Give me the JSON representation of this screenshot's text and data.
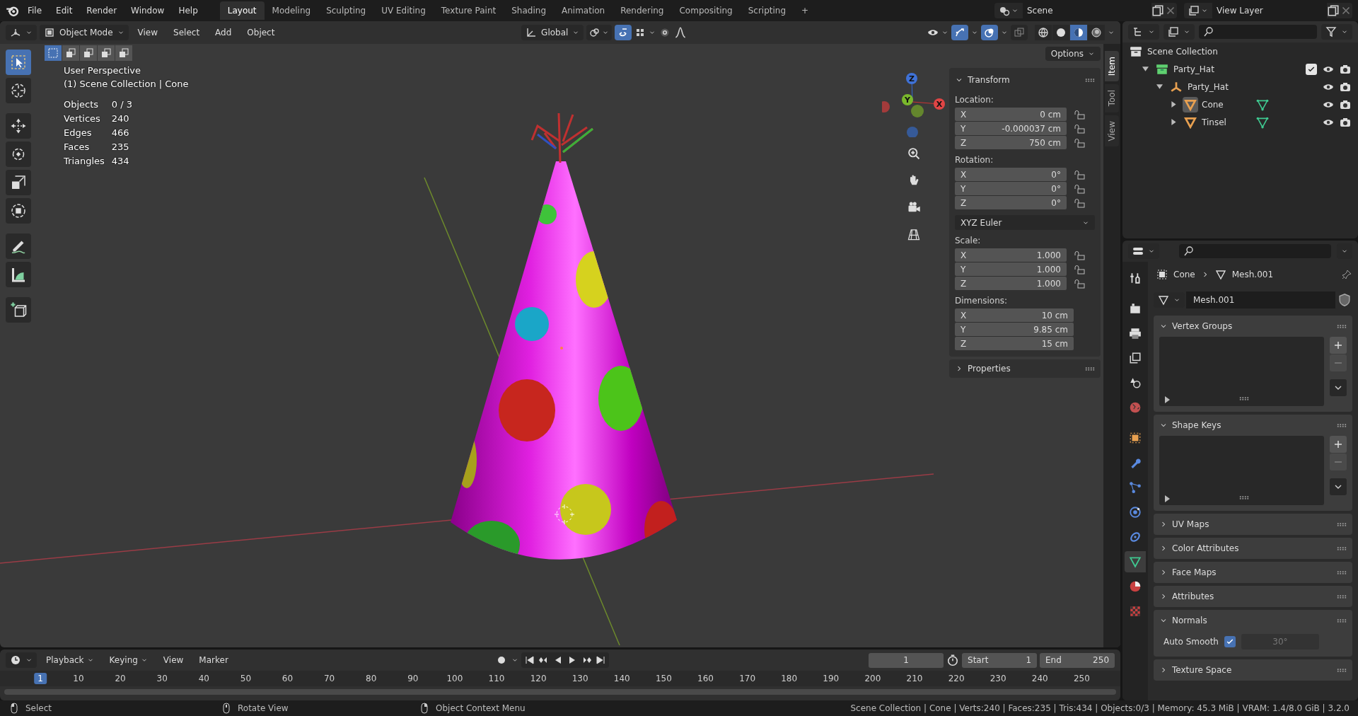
{
  "menu": [
    "File",
    "Edit",
    "Render",
    "Window",
    "Help"
  ],
  "workspaces": [
    {
      "label": "Layout",
      "selected": true
    },
    {
      "label": "Modeling",
      "selected": false
    },
    {
      "label": "Sculpting",
      "selected": false
    },
    {
      "label": "UV Editing",
      "selected": false
    },
    {
      "label": "Texture Paint",
      "selected": false
    },
    {
      "label": "Shading",
      "selected": false
    },
    {
      "label": "Animation",
      "selected": false
    },
    {
      "label": "Rendering",
      "selected": false
    },
    {
      "label": "Compositing",
      "selected": false
    },
    {
      "label": "Scripting",
      "selected": false
    }
  ],
  "add_workspace": "+",
  "scene": "Scene",
  "view_layer": "View Layer",
  "viewport_header": {
    "mode": "Object Mode",
    "menus": [
      "View",
      "Select",
      "Add",
      "Object"
    ],
    "orientation": "Global",
    "options": "Options",
    "toggles": [
      {
        "kind": "snap",
        "on": true
      },
      {
        "kind": "gizmos",
        "on": true
      },
      {
        "kind": "overlays",
        "on": true
      },
      {
        "kind": "xray",
        "on": false
      }
    ],
    "shading": [
      {
        "kind": "wireframe",
        "selected": false
      },
      {
        "kind": "solid",
        "selected": false
      },
      {
        "kind": "material",
        "selected": true
      },
      {
        "kind": "rendered",
        "selected": false
      }
    ],
    "select_modes": [
      {
        "kind": "new",
        "selected": true
      },
      {
        "kind": "extend",
        "selected": false
      },
      {
        "kind": "subtract",
        "selected": false
      },
      {
        "kind": "invert",
        "selected": false
      },
      {
        "kind": "intersect",
        "selected": false
      }
    ]
  },
  "tools": [
    {
      "kind": "select",
      "selected": true
    },
    {
      "kind": "cursor",
      "selected": false
    },
    {
      "kind": "move",
      "selected": false
    },
    {
      "kind": "rotate",
      "selected": false
    },
    {
      "kind": "scale",
      "selected": false
    },
    {
      "kind": "transform",
      "selected": false
    },
    {
      "kind": "annotate",
      "selected": false
    },
    {
      "kind": "measure",
      "selected": false
    },
    {
      "kind": "add_cube",
      "selected": false
    }
  ],
  "overlay": {
    "view": "User Perspective",
    "context": "(1) Scene Collection | Cone",
    "stats": [
      {
        "label": "Objects",
        "value": "0 / 3"
      },
      {
        "label": "Vertices",
        "value": "240"
      },
      {
        "label": "Edges",
        "value": "466"
      },
      {
        "label": "Faces",
        "value": "235"
      },
      {
        "label": "Triangles",
        "value": "434"
      }
    ]
  },
  "gizmo_axes": [
    "Z",
    "Y",
    "X"
  ],
  "n_panel": {
    "tabs": [
      {
        "label": "Item",
        "selected": true
      },
      {
        "label": "Tool",
        "selected": false
      },
      {
        "label": "View",
        "selected": false
      }
    ],
    "transform": {
      "title": "Transform",
      "expanded": true,
      "groups": [
        {
          "kind": "vector",
          "label": "Location:",
          "fields": [
            {
              "axis": "X",
              "value": "0 cm",
              "locked": false
            },
            {
              "axis": "Y",
              "value": "-0.000037 cm",
              "locked": false
            },
            {
              "axis": "Z",
              "value": "750 cm",
              "locked": false
            }
          ]
        },
        {
          "kind": "vector",
          "label": "Rotation:",
          "fields": [
            {
              "axis": "X",
              "value": "0°",
              "locked": false
            },
            {
              "axis": "Y",
              "value": "0°",
              "locked": false
            },
            {
              "axis": "Z",
              "value": "0°",
              "locked": false
            }
          ]
        },
        {
          "kind": "dropdown",
          "value": "XYZ Euler"
        },
        {
          "kind": "vector",
          "label": "Scale:",
          "fields": [
            {
              "axis": "X",
              "value": "1.000",
              "locked": false
            },
            {
              "axis": "Y",
              "value": "1.000",
              "locked": false
            },
            {
              "axis": "Z",
              "value": "1.000",
              "locked": false
            }
          ]
        },
        {
          "kind": "vector",
          "label": "Dimensions:",
          "fields": [
            {
              "axis": "X",
              "value": "10 cm"
            },
            {
              "axis": "Y",
              "value": "9.85 cm"
            },
            {
              "axis": "Z",
              "value": "15 cm"
            }
          ]
        }
      ]
    },
    "properties": {
      "title": "Properties",
      "expanded": false
    }
  },
  "outliner": {
    "tree": [
      {
        "name": "Scene Collection",
        "kind": "scene_collection",
        "children": [
          {
            "name": "Party_Hat",
            "kind": "collection",
            "expanded": true,
            "included": true,
            "children": [
              {
                "name": "Party_Hat",
                "kind": "empty",
                "expanded": true,
                "children": [
                  {
                    "name": "Cone",
                    "kind": "mesh",
                    "expanded": false,
                    "active": true
                  },
                  {
                    "name": "Tinsel",
                    "kind": "mesh",
                    "expanded": false,
                    "active": false
                  }
                ]
              }
            ]
          }
        ]
      }
    ]
  },
  "properties": {
    "tabs": [
      {
        "kind": "tool",
        "selected": false
      },
      {
        "kind": "render",
        "selected": false
      },
      {
        "kind": "output",
        "selected": false
      },
      {
        "kind": "view_layer",
        "selected": false
      },
      {
        "kind": "scene",
        "selected": false
      },
      {
        "kind": "world",
        "selected": false
      },
      {
        "kind": "object",
        "selected": false
      },
      {
        "kind": "modifiers",
        "selected": false
      },
      {
        "kind": "particles",
        "selected": false
      },
      {
        "kind": "physics",
        "selected": false
      },
      {
        "kind": "constraints",
        "selected": false
      },
      {
        "kind": "data",
        "selected": true
      },
      {
        "kind": "material",
        "selected": false
      },
      {
        "kind": "texture",
        "selected": false
      }
    ],
    "breadcrumb": [
      "Cone",
      "Mesh.001"
    ],
    "datablock": "Mesh.001",
    "panels": [
      {
        "title": "Vertex Groups",
        "kind": "list",
        "expanded": true
      },
      {
        "title": "Shape Keys",
        "kind": "list",
        "expanded": true
      },
      {
        "title": "UV Maps",
        "kind": "plain",
        "expanded": false
      },
      {
        "title": "Color Attributes",
        "kind": "plain",
        "expanded": false
      },
      {
        "title": "Face Maps",
        "kind": "plain",
        "expanded": false
      },
      {
        "title": "Attributes",
        "kind": "plain",
        "expanded": false
      },
      {
        "title": "Normals",
        "kind": "normals",
        "expanded": true,
        "option": {
          "label": "Auto Smooth",
          "checked": true,
          "angle": "30°"
        }
      },
      {
        "title": "Texture Space",
        "kind": "plain",
        "expanded": false
      }
    ]
  },
  "timeline": {
    "menus": [
      "Playback",
      "Keying",
      "View",
      "Marker"
    ],
    "current_frame": "1",
    "start_label": "Start",
    "start": "1",
    "end_label": "End",
    "end": "250",
    "frames": [
      {
        "label": "1",
        "selected": true
      },
      {
        "label": "10",
        "selected": false
      },
      {
        "label": "20",
        "selected": false
      },
      {
        "label": "30",
        "selected": false
      },
      {
        "label": "40",
        "selected": false
      },
      {
        "label": "50",
        "selected": false
      },
      {
        "label": "60",
        "selected": false
      },
      {
        "label": "70",
        "selected": false
      },
      {
        "label": "80",
        "selected": false
      },
      {
        "label": "90",
        "selected": false
      },
      {
        "label": "100",
        "selected": false
      },
      {
        "label": "110",
        "selected": false
      },
      {
        "label": "120",
        "selected": false
      },
      {
        "label": "130",
        "selected": false
      },
      {
        "label": "140",
        "selected": false
      },
      {
        "label": "150",
        "selected": false
      },
      {
        "label": "160",
        "selected": false
      },
      {
        "label": "170",
        "selected": false
      },
      {
        "label": "180",
        "selected": false
      },
      {
        "label": "190",
        "selected": false
      },
      {
        "label": "200",
        "selected": false
      },
      {
        "label": "210",
        "selected": false
      },
      {
        "label": "220",
        "selected": false
      },
      {
        "label": "230",
        "selected": false
      },
      {
        "label": "240",
        "selected": false
      },
      {
        "label": "250",
        "selected": false
      }
    ]
  },
  "status_bar": {
    "hints": [
      {
        "kind": "left",
        "text": "Select"
      },
      {
        "kind": "middle",
        "text": "Rotate View"
      },
      {
        "kind": "right",
        "text": "Object Context Menu"
      }
    ],
    "info": "Scene Collection | Cone | Verts:240 | Faces:235 | Tris:434 | Objects:0/3 | Memory: 45.3 MiB | VRAM: 1.4/8.0 GiB | 3.2.0"
  }
}
